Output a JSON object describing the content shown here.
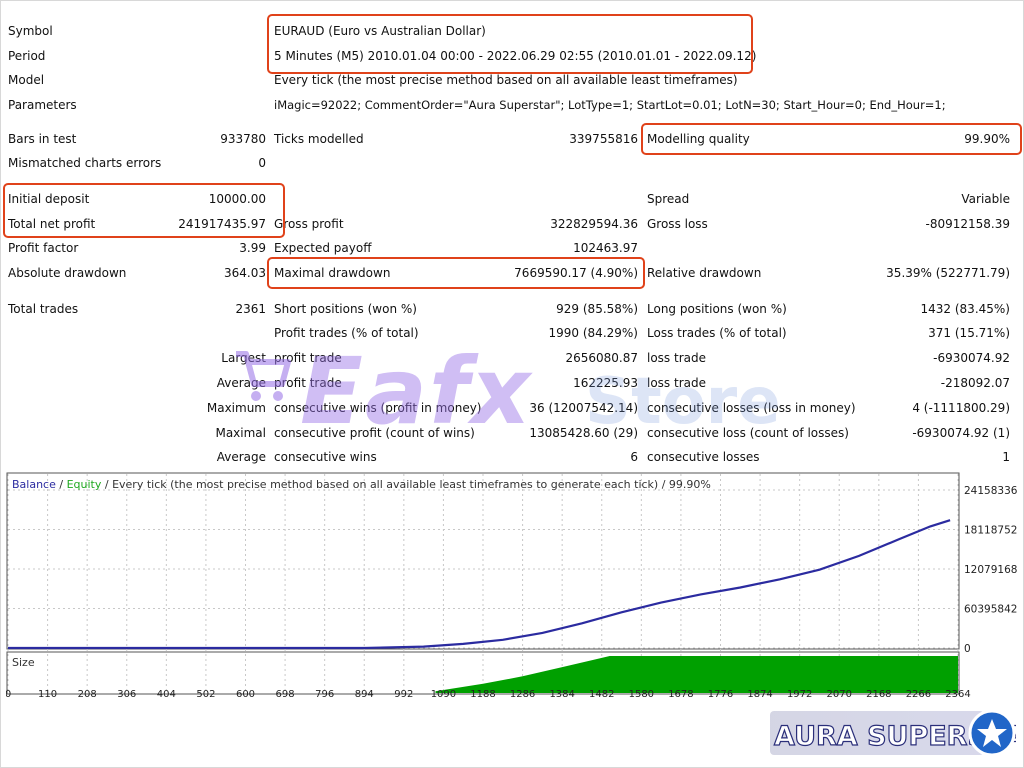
{
  "report": {
    "symbol_label": "Symbol",
    "symbol_value": "EURAUD (Euro vs Australian Dollar)",
    "period_label": "Period",
    "period_value": "5 Minutes (M5) 2010.01.04 00:00 - 2022.06.29 02:55 (2010.01.01 - 2022.09.12)",
    "model_label": "Model",
    "model_value": "Every tick (the most precise method based on all available least timeframes)",
    "parameters_label": "Parameters",
    "parameters_value": "iMagic=92022; CommentOrder=\"Aura Superstar\"; LotType=1; StartLot=0.01; LotN=30; Start_Hour=0; End_Hour=1;",
    "bars_label": "Bars in test",
    "bars_value": "933780",
    "ticks_label": "Ticks modelled",
    "ticks_value": "339755816",
    "quality_label": "Modelling quality",
    "quality_value": "99.90%",
    "mismatch_label": "Mismatched charts errors",
    "mismatch_value": "0",
    "deposit_label": "Initial deposit",
    "deposit_value": "10000.00",
    "spread_label": "Spread",
    "spread_value": "Variable",
    "netprofit_label": "Total net profit",
    "netprofit_value": "241917435.97",
    "grossprofit_label": "Gross profit",
    "grossprofit_value": "322829594.36",
    "grossloss_label": "Gross loss",
    "grossloss_value": "-80912158.39",
    "pf_label": "Profit factor",
    "pf_value": "3.99",
    "payoff_label": "Expected payoff",
    "payoff_value": "102463.97",
    "absdd_label": "Absolute drawdown",
    "absdd_value": "364.03",
    "maxdd_label": "Maximal drawdown",
    "maxdd_value": "7669590.17 (4.90%)",
    "reldd_label": "Relative drawdown",
    "reldd_value": "35.39% (522771.79)",
    "trades_label": "Total trades",
    "trades_value": "2361",
    "short_label": "Short positions (won %)",
    "short_value": "929 (85.58%)",
    "long_label": "Long positions (won %)",
    "long_value": "1432 (83.45%)",
    "ptrades_label": "Profit trades (% of total)",
    "ptrades_value": "1990 (84.29%)",
    "ltrades_label": "Loss trades (% of total)",
    "ltrades_value": "371 (15.71%)",
    "largest_label": "Largest",
    "largest_p_label": "profit trade",
    "largest_p_value": "2656080.87",
    "largest_l_label": "loss trade",
    "largest_l_value": "-6930074.92",
    "average_label": "Average",
    "average_p_label": "profit trade",
    "average_p_value": "162225.93",
    "average_l_label": "loss trade",
    "average_l_value": "-218092.07",
    "maximum_label": "Maximum",
    "maxw_label": "consecutive wins (profit in money)",
    "maxw_value": "36 (12007542.14)",
    "maxl_label": "consecutive losses (loss in money)",
    "maxl_value": "4 (-1111800.29)",
    "maximal_label": "Maximal",
    "maxp_label": "consecutive profit (count of wins)",
    "maxp_value": "13085428.60 (29)",
    "maxlc_label": "consecutive loss (count of losses)",
    "maxlc_value": "-6930074.92 (1)",
    "avg2_label": "Average",
    "avgw_label": "consecutive wins",
    "avgw_value": "6",
    "avgl_label": "consecutive losses",
    "avgl_value": "1"
  },
  "watermark": {
    "text": "Eafx",
    "text2": "Store"
  },
  "chart_data": {
    "type": "line",
    "legend_balance": "Balance",
    "legend_sep": " / ",
    "legend_equity": "Equity",
    "legend_rest": " / Every tick (the most precise method based on all available least timeframes to generate each tick) / 99.90%",
    "size_label": "Size",
    "y_ticks": [
      "24158336",
      "18118752",
      "12079168",
      "60395842",
      "0"
    ],
    "x_ticks": [
      "0",
      "110",
      "208",
      "306",
      "404",
      "502",
      "600",
      "698",
      "796",
      "894",
      "992",
      "1090",
      "1188",
      "1286",
      "1384",
      "1482",
      "1580",
      "1678",
      "1776",
      "1874",
      "1972",
      "2070",
      "2168",
      "2266",
      "2364"
    ],
    "ylim": [
      0,
      24158336
    ],
    "xlim": [
      0,
      2400
    ],
    "series": [
      {
        "name": "Balance",
        "color": "#2b2ba0",
        "points": [
          [
            0,
            0
          ],
          [
            900,
            0
          ],
          [
            1050,
            200000
          ],
          [
            1150,
            600000
          ],
          [
            1250,
            1200000
          ],
          [
            1350,
            2200000
          ],
          [
            1450,
            3600000
          ],
          [
            1550,
            5200000
          ],
          [
            1650,
            6600000
          ],
          [
            1750,
            7800000
          ],
          [
            1850,
            8800000
          ],
          [
            1950,
            10000000
          ],
          [
            2050,
            11400000
          ],
          [
            2150,
            13400000
          ],
          [
            2250,
            15800000
          ],
          [
            2330,
            17700000
          ],
          [
            2380,
            18600000
          ]
        ]
      }
    ],
    "size": {
      "color": "#00a000",
      "points": [
        [
          1080,
          0.05
        ],
        [
          1200,
          0.25
        ],
        [
          1300,
          0.45
        ],
        [
          1400,
          0.7
        ],
        [
          1480,
          0.9
        ],
        [
          1520,
          1
        ],
        [
          2400,
          1
        ]
      ]
    }
  },
  "badge": {
    "text": "AURA SUPERSTAR"
  },
  "colors": {
    "highlight": "#e0421a",
    "balance": "#2b2ba0",
    "equity": "#00a000",
    "size": "#00a000"
  }
}
